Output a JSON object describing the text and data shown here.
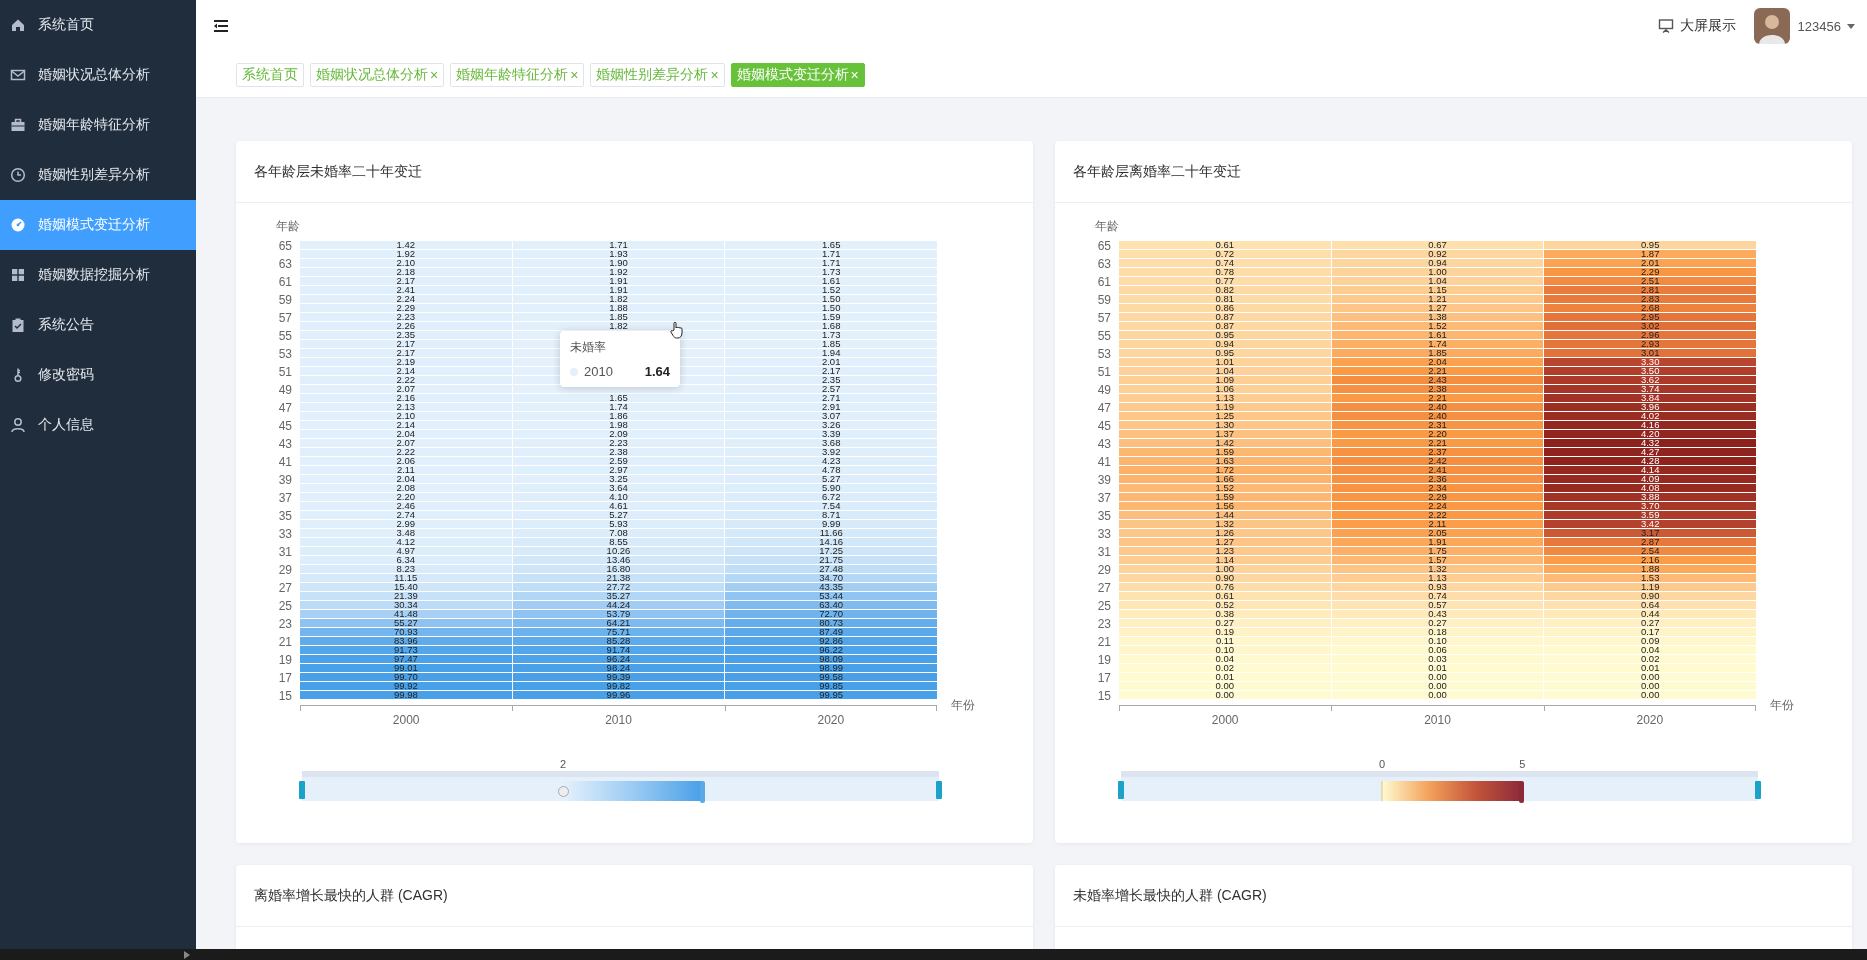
{
  "sidebar": {
    "items": [
      {
        "label": "系统首页",
        "selected": false
      },
      {
        "label": "婚姻状况总体分析",
        "selected": false
      },
      {
        "label": "婚姻年龄特征分析",
        "selected": false
      },
      {
        "label": "婚姻性别差异分析",
        "selected": false
      },
      {
        "label": "婚姻模式变迁分析",
        "selected": true
      },
      {
        "label": "婚姻数据挖掘分析",
        "selected": false
      },
      {
        "label": "系统公告",
        "selected": false
      },
      {
        "label": "修改密码",
        "selected": false
      },
      {
        "label": "个人信息",
        "selected": false
      }
    ]
  },
  "topbar": {
    "big_screen_label": "大屏展示",
    "username": "123456"
  },
  "tabs": [
    {
      "label": "系统首页",
      "selected": false
    },
    {
      "label": "婚姻状况总体分析",
      "close": "×",
      "selected": false
    },
    {
      "label": "婚姻年龄特征分析",
      "close": "×",
      "selected": false
    },
    {
      "label": "婚姻性别差异分析",
      "close": "×",
      "selected": false
    },
    {
      "label": "婚姻模式变迁分析",
      "close": "×",
      "selected": true
    }
  ],
  "panels": [
    {
      "title": "各年龄层未婚率二十年变迁",
      "kind": "heatmap",
      "y_axis_name": "年龄",
      "x_axis_name": "年份",
      "y_ticks": [
        "65",
        "63",
        "61",
        "59",
        "57",
        "55",
        "53",
        "51",
        "49",
        "47",
        "45",
        "43",
        "41",
        "39",
        "37",
        "35",
        "33",
        "31",
        "29",
        "27",
        "25",
        "23",
        "21",
        "19",
        "17",
        "15"
      ],
      "columns": [
        {
          "year": "2000",
          "cells": [
            "1.42",
            "1.92",
            "2.10",
            "2.18",
            "2.17",
            "2.41",
            "2.24",
            "2.29",
            "2.23",
            "2.26",
            "2.35",
            "2.17",
            "2.17",
            "2.19",
            "2.14",
            "2.22",
            "2.07",
            "2.16",
            "2.13",
            "2.10",
            "2.14",
            "2.04",
            "2.07",
            "2.22",
            "2.06",
            "2.11",
            "2.04",
            "2.08",
            "2.20",
            "2.46",
            "2.74",
            "2.99",
            "3.48",
            "4.12",
            "4.97",
            "6.34",
            "8.23",
            "11.15",
            "15.40",
            "21.39",
            "30.34",
            "41.48",
            "55.27",
            "70.93",
            "83.96",
            "91.73",
            "97.47",
            "99.01",
            "99.70",
            "99.92",
            "99.98"
          ]
        },
        {
          "year": "2010",
          "cells": [
            "1.71",
            "1.93",
            "1.90",
            "1.92",
            "1.91",
            "1.91",
            "1.82",
            "1.88",
            "1.85",
            "1.82",
            null,
            null,
            null,
            null,
            null,
            null,
            null,
            "1.65",
            "1.74",
            "1.86",
            "1.98",
            "2.09",
            "2.23",
            "2.38",
            "2.59",
            "2.97",
            "3.25",
            "3.64",
            "4.10",
            "4.61",
            "5.27",
            "5.93",
            "7.08",
            "8.55",
            "10.26",
            "13.46",
            "16.80",
            "21.38",
            "27.72",
            "35.27",
            "44.24",
            "53.79",
            "64.21",
            "75.71",
            "85.28",
            "91.74",
            "96.24",
            "98.24",
            "99.39",
            "99.82",
            "99.96"
          ]
        },
        {
          "year": "2020",
          "cells": [
            "1.65",
            "1.71",
            "1.71",
            "1.73",
            "1.61",
            "1.52",
            "1.50",
            "1.50",
            "1.59",
            "1.68",
            "1.73",
            "1.85",
            "1.94",
            "2.01",
            "2.17",
            "2.35",
            "2.57",
            "2.71",
            "2.91",
            "3.07",
            "3.26",
            "3.39",
            "3.68",
            "3.92",
            "4.23",
            "4.78",
            "5.27",
            "5.90",
            "6.72",
            "7.54",
            "8.71",
            "9.99",
            "11.66",
            "14.16",
            "17.25",
            "21.75",
            "27.48",
            "34.70",
            "43.35",
            "53.44",
            "63.40",
            "72.70",
            "80.73",
            "87.49",
            "92.86",
            "96.22",
            "98.09",
            "98.99",
            "99.58",
            "99.85",
            "99.95"
          ]
        }
      ],
      "visual_map": {
        "start": {
          "level": 0.41
        },
        "end": {
          "level": 0.63
        },
        "hover_marker": true,
        "labels": [
          "2"
        ]
      },
      "tooltip": {
        "title": "未婚率",
        "series": "2010",
        "value": "1.64"
      }
    },
    {
      "title": "各年龄层离婚率二十年变迁",
      "kind": "heatmap",
      "y_axis_name": "年龄",
      "x_axis_name": "年份",
      "y_ticks": [
        "65",
        "63",
        "61",
        "59",
        "57",
        "55",
        "53",
        "51",
        "49",
        "47",
        "45",
        "43",
        "41",
        "39",
        "37",
        "35",
        "33",
        "31",
        "29",
        "27",
        "25",
        "23",
        "21",
        "19",
        "17",
        "15"
      ],
      "columns": [
        {
          "year": "2000",
          "cells": [
            "0.61",
            "0.72",
            "0.74",
            "0.78",
            "0.77",
            "0.82",
            "0.81",
            "0.86",
            "0.87",
            "0.87",
            "0.95",
            "0.94",
            "0.95",
            "1.01",
            "1.04",
            "1.09",
            "1.06",
            "1.13",
            "1.19",
            "1.25",
            "1.30",
            "1.37",
            "1.42",
            "1.59",
            "1.63",
            "1.72",
            "1.66",
            "1.52",
            "1.59",
            "1.56",
            "1.44",
            "1.32",
            "1.26",
            "1.27",
            "1.23",
            "1.14",
            "1.00",
            "0.90",
            "0.76",
            "0.61",
            "0.52",
            "0.38",
            "0.27",
            "0.19",
            "0.11",
            "0.10",
            "0.04",
            "0.02",
            "0.01",
            "0.00",
            "0.00"
          ]
        },
        {
          "year": "2010",
          "cells": [
            "0.67",
            "0.92",
            "0.94",
            "1.00",
            "1.04",
            "1.15",
            "1.21",
            "1.27",
            "1.38",
            "1.52",
            "1.61",
            "1.74",
            "1.85",
            "2.04",
            "2.21",
            "2.43",
            "2.38",
            "2.21",
            "2.40",
            "2.40",
            "2.31",
            "2.20",
            "2.21",
            "2.37",
            "2.42",
            "2.41",
            "2.36",
            "2.34",
            "2.29",
            "2.24",
            "2.22",
            "2.11",
            "2.05",
            "1.91",
            "1.75",
            "1.57",
            "1.32",
            "1.13",
            "0.93",
            "0.74",
            "0.57",
            "0.43",
            "0.27",
            "0.18",
            "0.10",
            "0.06",
            "0.03",
            "0.01",
            "0.00",
            "0.00",
            "0.00"
          ]
        },
        {
          "year": "2020",
          "cells": [
            "0.95",
            "1.87",
            "2.01",
            "2.29",
            "2.51",
            "2.81",
            "2.83",
            "2.68",
            "2.95",
            "3.02",
            "2.96",
            "2.93",
            "3.01",
            "3.30",
            "3.50",
            "3.62",
            "3.74",
            "3.84",
            "3.96",
            "4.02",
            "4.16",
            "4.20",
            "4.32",
            "4.27",
            "4.28",
            "4.14",
            "4.09",
            "4.08",
            "3.88",
            "3.70",
            "3.59",
            "3.42",
            "3.17",
            "2.87",
            "2.54",
            "2.16",
            "1.88",
            "1.53",
            "1.19",
            "0.90",
            "0.64",
            "0.44",
            "0.27",
            "0.17",
            "0.09",
            "0.04",
            "0.02",
            "0.01",
            "0.00",
            "0.00",
            "0.00"
          ]
        }
      ],
      "visual_map": {
        "start": {
          "level": 0.41
        },
        "end": {
          "level": 0.63
        },
        "hover_marker": false,
        "labels": [
          "0",
          "5"
        ]
      }
    },
    {
      "title": "离婚率增长最快的人群 (CAGR)",
      "kind": "empty"
    },
    {
      "title": "未婚率增长最快的人群 (CAGR)",
      "kind": "empty"
    }
  ]
}
